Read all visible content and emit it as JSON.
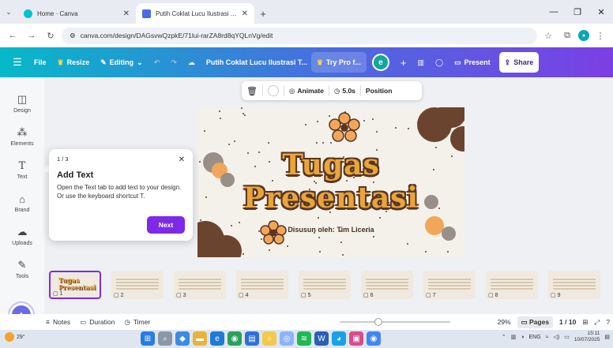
{
  "browser": {
    "tabs": [
      {
        "title": "Home · Canva",
        "active": false
      },
      {
        "title": "Putih Coklat Lucu Ilustrasi Tugas",
        "active": true
      }
    ],
    "url": "canva.com/design/DAGsvwQzpkE/71lui-rarZA8rd8qYQLnVg/edit"
  },
  "toolbar": {
    "file": "File",
    "resize": "Resize",
    "editing": "Editing",
    "doc_title": "Putih Coklat Lucu Ilustrasi T...",
    "try_pro": "Try Pro f...",
    "avatar_initial": "e",
    "present": "Present",
    "share": "Share"
  },
  "sidebar": {
    "items": [
      {
        "label": "Design",
        "icon": "layout-icon"
      },
      {
        "label": "Elements",
        "icon": "shapes-icon"
      },
      {
        "label": "Text",
        "icon": "text-icon"
      },
      {
        "label": "Brand",
        "icon": "brand-icon"
      },
      {
        "label": "Uploads",
        "icon": "cloud-upload-icon"
      },
      {
        "label": "Tools",
        "icon": "pen-icon"
      }
    ]
  },
  "element_toolbar": {
    "animate": "Animate",
    "duration": "5.0s",
    "position": "Position"
  },
  "slide": {
    "title_line1": "Tugas",
    "title_line2": "Presentasi",
    "subtitle": "Disusun oleh: Tim Liceria"
  },
  "popup": {
    "step": "1 / 3",
    "title": "Add Text",
    "body": "Open the Text tab to add text to your design. Or use the keyboard shortcut T.",
    "next": "Next"
  },
  "thumbnails": [
    {
      "number": "1",
      "mini_title": "Tugas Presentasi"
    },
    {
      "number": "2"
    },
    {
      "number": "3"
    },
    {
      "number": "4"
    },
    {
      "number": "5"
    },
    {
      "number": "6"
    },
    {
      "number": "7"
    },
    {
      "number": "8"
    },
    {
      "number": "9"
    }
  ],
  "footer": {
    "notes": "Notes",
    "duration": "Duration",
    "timer": "Timer",
    "zoom": "29%",
    "zoom_fraction": 0.35,
    "pages": "Pages",
    "page_count": "1 / 10"
  },
  "taskbar": {
    "temperature": "29°",
    "lang": "ENG",
    "time": "15:11",
    "date": "10/07/2025"
  },
  "colors": {
    "accent": "#7d2ae8",
    "title_fill": "#e8a53a",
    "title_outline": "#5a3520"
  }
}
